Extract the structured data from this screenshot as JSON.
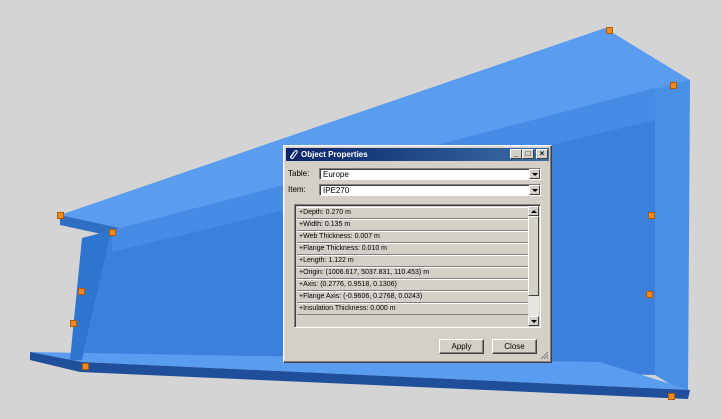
{
  "dialog": {
    "title": "Object Properties",
    "buttons": {
      "minimize": "_",
      "maximize": "□",
      "close": "×"
    },
    "table_label": "Table:",
    "table_value": "Europe",
    "item_label": "Item:",
    "item_value": "IPE270",
    "properties": [
      "+Depth: 0.270 m",
      "+Width: 0.135 m",
      "+Web Thickness: 0.007 m",
      "+Flange Thickness: 0.010 m",
      "+Length: 1.122 m",
      "+Origin: (1006.617, 5037.831, 110.453) m",
      "+Axis: (0.2776, 0.9518, 0.1306)",
      "+Flange Axis: (-0.9606, 0.2768, 0.0243)",
      "+Insulation Thickness: 0.000 m"
    ],
    "apply_label": "Apply",
    "close_label": "Close"
  },
  "icons": {
    "title_icon": "paperclip-icon",
    "grip": "resize-grip-icon"
  },
  "colors": {
    "beam": "#3f86e0",
    "handle": "#f08a1e",
    "titlebar": "#0a246a",
    "background": "#d4d4d4"
  }
}
